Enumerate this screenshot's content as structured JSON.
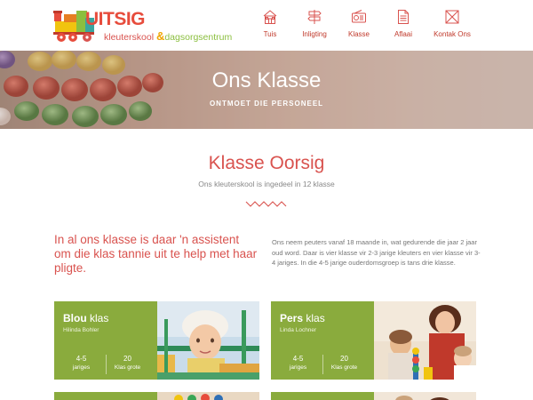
{
  "header": {
    "logo": {
      "word": "UITSIG",
      "sub_a": "kleuterskool ",
      "sub_amp": "&",
      "sub_b": "dagsorgsentrum"
    },
    "nav": [
      {
        "label": "Tuis",
        "icon": "house-icon"
      },
      {
        "label": "Inligting",
        "icon": "signpost-icon"
      },
      {
        "label": "Klasse",
        "icon": "radio-icon"
      },
      {
        "label": "Aflaai",
        "icon": "document-icon"
      },
      {
        "label": "Kontak Ons",
        "icon": "envelope-icon"
      }
    ]
  },
  "hero": {
    "title": "Ons Klasse",
    "subtitle": "ONTMOET DIE PERSONEEL"
  },
  "section": {
    "title": "Klasse Oorsig",
    "subtitle": "Ons kleuterskool is ingedeel in 12 klasse"
  },
  "intro": {
    "lead": "In al ons klasse is daar 'n assistent om die klas tannie uit te help met haar pligte.",
    "text": "Ons neem peuters vanaf 18 maande in, wat gedurende die jaar 2 jaar oud word. Daar is vier klasse vir 2-3 jarige kleuters en vier klasse vir 3-4 jariges. In die 4-5 jarige ouderdomsgroep is tans drie klasse."
  },
  "classes": [
    {
      "name": "Blou",
      "suffix": "klas",
      "teacher": "Hilinda Bohler",
      "age": "4-5",
      "age_label": "jariges",
      "size": "20",
      "size_label": "Klas grote"
    },
    {
      "name": "Pers",
      "suffix": "klas",
      "teacher": "Linda Lochner",
      "age": "4-5",
      "age_label": "jariges",
      "size": "20",
      "size_label": "Klas grote"
    }
  ],
  "colors": {
    "accent": "#d9534f",
    "card": "#8aab3d"
  }
}
